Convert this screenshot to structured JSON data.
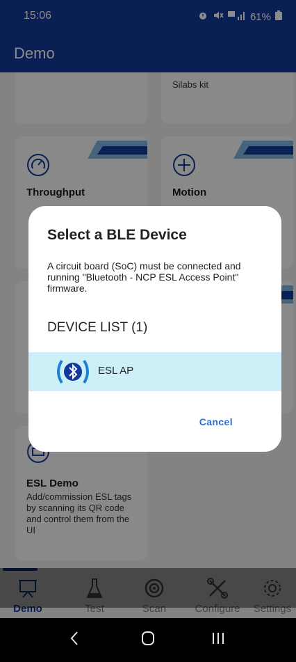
{
  "status_bar": {
    "time": "15:06",
    "battery": "61%"
  },
  "app_bar": {
    "title": "Demo"
  },
  "cards": {
    "top_right_desc": "Silabs kit",
    "throughput_title": "Throughput",
    "motion_title": "Motion",
    "esl_title": "ESL Demo",
    "esl_desc": "Add/commission ESL tags by scanning its QR code and control them from the UI"
  },
  "dialog": {
    "title": "Select a BLE Device",
    "message": "A circuit board (SoC) must be connected and running \"Bluetooth - NCP ESL Access Point\" firmware.",
    "list_title": "DEVICE LIST (1)",
    "device_name": "ESL AP",
    "cancel_label": "Cancel"
  },
  "bottom_nav": {
    "items": [
      {
        "label": "Demo",
        "icon": "presentation-board-icon",
        "active": true
      },
      {
        "label": "Test",
        "icon": "flask-icon",
        "active": false
      },
      {
        "label": "Scan",
        "icon": "scan-target-icon",
        "active": false
      },
      {
        "label": "Configure",
        "icon": "tools-icon",
        "active": false
      },
      {
        "label": "Settings",
        "icon": "gear-icon",
        "active": false
      }
    ]
  },
  "colors": {
    "brand": "#13399a",
    "accent_link": "#2f6ecf",
    "selected_row": "#cdeff8",
    "ble_icon": "#1f7fd4"
  }
}
